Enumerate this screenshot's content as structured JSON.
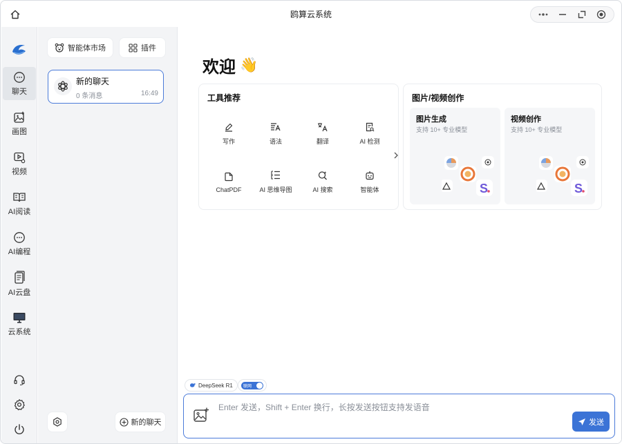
{
  "window": {
    "title": "鸥算云系统"
  },
  "nav": {
    "items": [
      {
        "label": "聊天",
        "icon": "chat-bubble-icon",
        "active": true
      },
      {
        "label": "画图",
        "icon": "image-plus-icon"
      },
      {
        "label": "视频",
        "icon": "video-icon"
      },
      {
        "label": "AI阅读",
        "icon": "book-icon"
      },
      {
        "label": "AI编程",
        "icon": "chat-dots-icon"
      },
      {
        "label": "AI云盘",
        "icon": "document-icon"
      },
      {
        "label": "云系统",
        "icon": "monitor-icon"
      }
    ],
    "bottom": [
      "headset-icon",
      "gear-icon",
      "power-icon"
    ]
  },
  "panel": {
    "market_label": "智能体市场",
    "plugin_label": "插件",
    "chat": {
      "name": "新的聊天",
      "meta": "0 条消息",
      "time": "16:49"
    },
    "new_chat_label": "新的聊天"
  },
  "main": {
    "welcome": "欢迎",
    "welcome_emoji": "👋",
    "tools_title": "工具推荐",
    "tools": [
      {
        "label": "写作",
        "icon": "pen-icon"
      },
      {
        "label": "语法",
        "icon": "grammar-icon"
      },
      {
        "label": "翻译",
        "icon": "translate-icon"
      },
      {
        "label": "AI 检测",
        "icon": "detect-icon"
      },
      {
        "label": "ChatPDF",
        "icon": "pdf-icon"
      },
      {
        "label": "AI 思维导图",
        "icon": "mindmap-icon"
      },
      {
        "label": "AI 搜索",
        "icon": "search-icon"
      },
      {
        "label": "智能体",
        "icon": "robot-icon"
      }
    ],
    "creation_title": "图片/视频创作",
    "creations": [
      {
        "title": "图片生成",
        "subtitle": "支持 10+ 专业模型"
      },
      {
        "title": "视频创作",
        "subtitle": "支持 10+ 专业模型"
      }
    ]
  },
  "composer": {
    "model_label": "DeepSeek R1",
    "toggle_label": "联网",
    "placeholder": "Enter 发送，Shift + Enter 换行，长按发送按钮支持发语音",
    "send_label": "发送"
  },
  "colors": {
    "accent": "#3b73d6",
    "border_active": "#4a7ad9"
  }
}
